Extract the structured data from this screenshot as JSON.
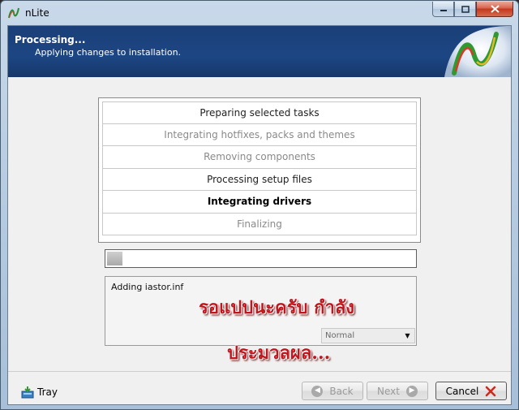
{
  "window": {
    "title": "nLite"
  },
  "header": {
    "title": "Processing...",
    "subtitle": "Applying changes to installation."
  },
  "steps": [
    {
      "label": "Preparing selected tasks",
      "state": "done"
    },
    {
      "label": "Integrating hotfixes, packs and themes",
      "state": "skipped"
    },
    {
      "label": "Removing components",
      "state": "skipped"
    },
    {
      "label": "Processing setup files",
      "state": "done"
    },
    {
      "label": "Integrating drivers",
      "state": "active"
    },
    {
      "label": "Finalizing",
      "state": "pending"
    }
  ],
  "progress": {
    "fraction": 0.05
  },
  "log": {
    "current": "Adding iastor.inf",
    "overlay_line1": "รอแปปนะครับ กำลัง",
    "overlay_line2": "ประมวลผล..."
  },
  "priority": {
    "selected": "Normal"
  },
  "footer": {
    "tray_label": "Tray",
    "back_label": "Back",
    "next_label": "Next",
    "cancel_label": "Cancel"
  },
  "colors": {
    "header_bg": "#1c4683",
    "overlay_text": "#c0161e",
    "close_red": "#c4371d"
  }
}
